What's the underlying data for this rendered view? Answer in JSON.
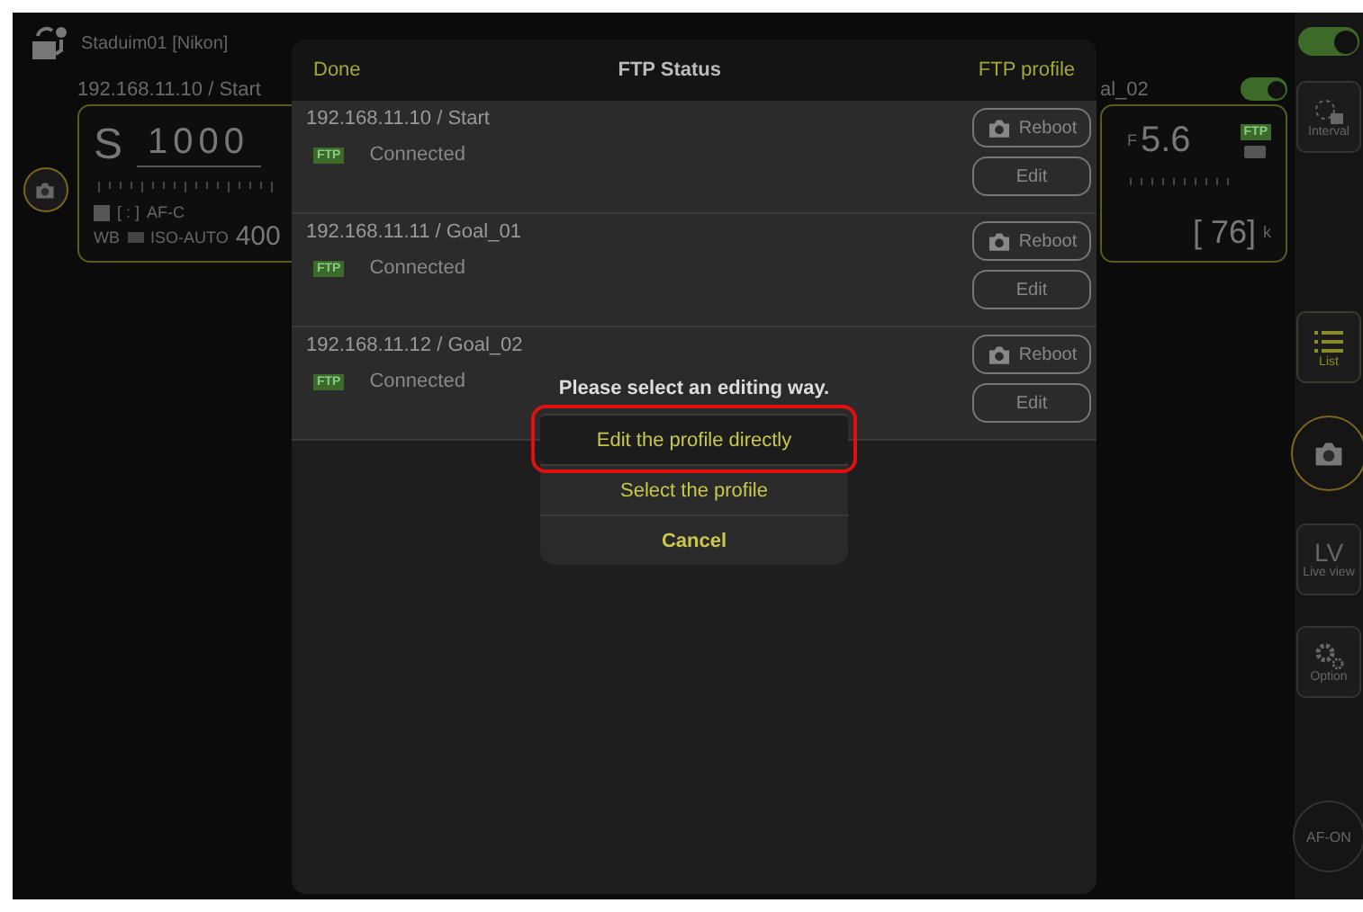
{
  "group": {
    "name": "Staduim01 [Nikon]"
  },
  "camera_left": {
    "label": "192.168.11.10 / Start",
    "mode": "S",
    "shutter": "1000",
    "metering": "[ : ]",
    "af_mode": "AF-C",
    "wb": "WB",
    "iso_label": "ISO-AUTO",
    "iso": "400"
  },
  "camera_right": {
    "label": "al_02",
    "enabled": true,
    "aperture_prefix": "F",
    "aperture": "5.6",
    "badge": "FTP",
    "frames": "[ 76]",
    "frames_unit": "k"
  },
  "sidebar": {
    "enabled": true,
    "items": [
      {
        "kind": "interval",
        "label": "Interval",
        "selected": false
      },
      {
        "kind": "list",
        "label": "List",
        "selected": true
      },
      {
        "kind": "shutter",
        "selected": false
      },
      {
        "kind": "liveview",
        "title": "LV",
        "label": "Live view",
        "selected": false
      },
      {
        "kind": "option",
        "label": "Option",
        "selected": false
      },
      {
        "kind": "afon",
        "label": "AF-ON",
        "selected": false
      }
    ]
  },
  "sheet": {
    "done": "Done",
    "title": "FTP Status",
    "profile": "FTP profile",
    "rows": [
      {
        "address": "192.168.11.10 / Start",
        "badge": "FTP",
        "status": "Connected",
        "reboot": "Reboot",
        "edit": "Edit"
      },
      {
        "address": "192.168.11.11 / Goal_01",
        "badge": "FTP",
        "status": "Connected",
        "reboot": "Reboot",
        "edit": "Edit"
      },
      {
        "address": "192.168.11.12 / Goal_02",
        "badge": "FTP",
        "status": "Connected",
        "reboot": "Reboot",
        "edit": "Edit"
      }
    ]
  },
  "alert": {
    "title": "Please select an editing way.",
    "options": [
      {
        "kind": "default",
        "label": "Edit the profile directly",
        "selected": true
      },
      {
        "kind": "default",
        "label": "Select the profile",
        "selected": false
      },
      {
        "kind": "cancel",
        "label": "Cancel",
        "selected": false
      }
    ]
  }
}
